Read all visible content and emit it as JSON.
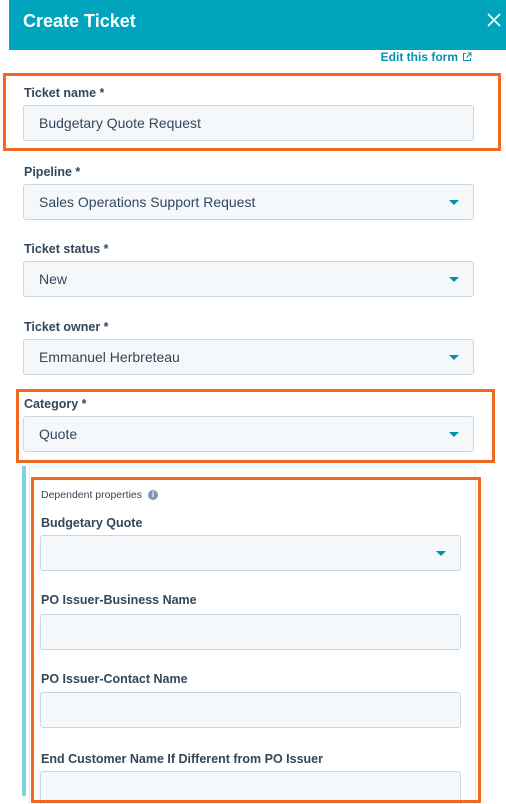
{
  "header": {
    "title": "Create Ticket"
  },
  "edit_form_link": "Edit this form",
  "fields": {
    "ticket_name": {
      "label": "Ticket name *",
      "value": "Budgetary Quote Request"
    },
    "pipeline": {
      "label": "Pipeline *",
      "value": "Sales Operations Support Request"
    },
    "ticket_status": {
      "label": "Ticket status *",
      "value": "New"
    },
    "ticket_owner": {
      "label": "Ticket owner *",
      "value": "Emmanuel Herbreteau"
    },
    "category": {
      "label": "Category *",
      "value": "Quote"
    }
  },
  "dependent": {
    "title": "Dependent properties",
    "budgetary_quote": {
      "label": "Budgetary Quote",
      "value": ""
    },
    "po_issuer_business_name": {
      "label": "PO Issuer-Business Name",
      "value": ""
    },
    "po_issuer_contact_name": {
      "label": "PO Issuer-Contact Name",
      "value": ""
    },
    "end_customer_name": {
      "label": "End Customer Name If Different from PO Issuer",
      "value": ""
    }
  },
  "colors": {
    "header_bg": "#00a4bd",
    "highlight": "#f26722",
    "link": "#0091ae"
  }
}
